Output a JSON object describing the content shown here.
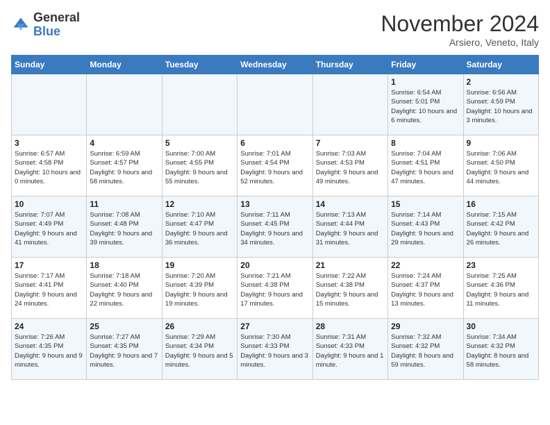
{
  "header": {
    "logo_general": "General",
    "logo_blue": "Blue",
    "month_title": "November 2024",
    "location": "Arsiero, Veneto, Italy"
  },
  "days_of_week": [
    "Sunday",
    "Monday",
    "Tuesday",
    "Wednesday",
    "Thursday",
    "Friday",
    "Saturday"
  ],
  "weeks": [
    [
      {
        "day": "",
        "info": ""
      },
      {
        "day": "",
        "info": ""
      },
      {
        "day": "",
        "info": ""
      },
      {
        "day": "",
        "info": ""
      },
      {
        "day": "",
        "info": ""
      },
      {
        "day": "1",
        "info": "Sunrise: 6:54 AM\nSunset: 5:01 PM\nDaylight: 10 hours and 6 minutes."
      },
      {
        "day": "2",
        "info": "Sunrise: 6:56 AM\nSunset: 4:59 PM\nDaylight: 10 hours and 3 minutes."
      }
    ],
    [
      {
        "day": "3",
        "info": "Sunrise: 6:57 AM\nSunset: 4:58 PM\nDaylight: 10 hours and 0 minutes."
      },
      {
        "day": "4",
        "info": "Sunrise: 6:59 AM\nSunset: 4:57 PM\nDaylight: 9 hours and 58 minutes."
      },
      {
        "day": "5",
        "info": "Sunrise: 7:00 AM\nSunset: 4:55 PM\nDaylight: 9 hours and 55 minutes."
      },
      {
        "day": "6",
        "info": "Sunrise: 7:01 AM\nSunset: 4:54 PM\nDaylight: 9 hours and 52 minutes."
      },
      {
        "day": "7",
        "info": "Sunrise: 7:03 AM\nSunset: 4:53 PM\nDaylight: 9 hours and 49 minutes."
      },
      {
        "day": "8",
        "info": "Sunrise: 7:04 AM\nSunset: 4:51 PM\nDaylight: 9 hours and 47 minutes."
      },
      {
        "day": "9",
        "info": "Sunrise: 7:06 AM\nSunset: 4:50 PM\nDaylight: 9 hours and 44 minutes."
      }
    ],
    [
      {
        "day": "10",
        "info": "Sunrise: 7:07 AM\nSunset: 4:49 PM\nDaylight: 9 hours and 41 minutes."
      },
      {
        "day": "11",
        "info": "Sunrise: 7:08 AM\nSunset: 4:48 PM\nDaylight: 9 hours and 39 minutes."
      },
      {
        "day": "12",
        "info": "Sunrise: 7:10 AM\nSunset: 4:47 PM\nDaylight: 9 hours and 36 minutes."
      },
      {
        "day": "13",
        "info": "Sunrise: 7:11 AM\nSunset: 4:45 PM\nDaylight: 9 hours and 34 minutes."
      },
      {
        "day": "14",
        "info": "Sunrise: 7:13 AM\nSunset: 4:44 PM\nDaylight: 9 hours and 31 minutes."
      },
      {
        "day": "15",
        "info": "Sunrise: 7:14 AM\nSunset: 4:43 PM\nDaylight: 9 hours and 29 minutes."
      },
      {
        "day": "16",
        "info": "Sunrise: 7:15 AM\nSunset: 4:42 PM\nDaylight: 9 hours and 26 minutes."
      }
    ],
    [
      {
        "day": "17",
        "info": "Sunrise: 7:17 AM\nSunset: 4:41 PM\nDaylight: 9 hours and 24 minutes."
      },
      {
        "day": "18",
        "info": "Sunrise: 7:18 AM\nSunset: 4:40 PM\nDaylight: 9 hours and 22 minutes."
      },
      {
        "day": "19",
        "info": "Sunrise: 7:20 AM\nSunset: 4:39 PM\nDaylight: 9 hours and 19 minutes."
      },
      {
        "day": "20",
        "info": "Sunrise: 7:21 AM\nSunset: 4:38 PM\nDaylight: 9 hours and 17 minutes."
      },
      {
        "day": "21",
        "info": "Sunrise: 7:22 AM\nSunset: 4:38 PM\nDaylight: 9 hours and 15 minutes."
      },
      {
        "day": "22",
        "info": "Sunrise: 7:24 AM\nSunset: 4:37 PM\nDaylight: 9 hours and 13 minutes."
      },
      {
        "day": "23",
        "info": "Sunrise: 7:25 AM\nSunset: 4:36 PM\nDaylight: 9 hours and 11 minutes."
      }
    ],
    [
      {
        "day": "24",
        "info": "Sunrise: 7:26 AM\nSunset: 4:35 PM\nDaylight: 9 hours and 9 minutes."
      },
      {
        "day": "25",
        "info": "Sunrise: 7:27 AM\nSunset: 4:35 PM\nDaylight: 9 hours and 7 minutes."
      },
      {
        "day": "26",
        "info": "Sunrise: 7:29 AM\nSunset: 4:34 PM\nDaylight: 9 hours and 5 minutes."
      },
      {
        "day": "27",
        "info": "Sunrise: 7:30 AM\nSunset: 4:33 PM\nDaylight: 9 hours and 3 minutes."
      },
      {
        "day": "28",
        "info": "Sunrise: 7:31 AM\nSunset: 4:33 PM\nDaylight: 9 hours and 1 minute."
      },
      {
        "day": "29",
        "info": "Sunrise: 7:32 AM\nSunset: 4:32 PM\nDaylight: 8 hours and 59 minutes."
      },
      {
        "day": "30",
        "info": "Sunrise: 7:34 AM\nSunset: 4:32 PM\nDaylight: 8 hours and 58 minutes."
      }
    ]
  ]
}
